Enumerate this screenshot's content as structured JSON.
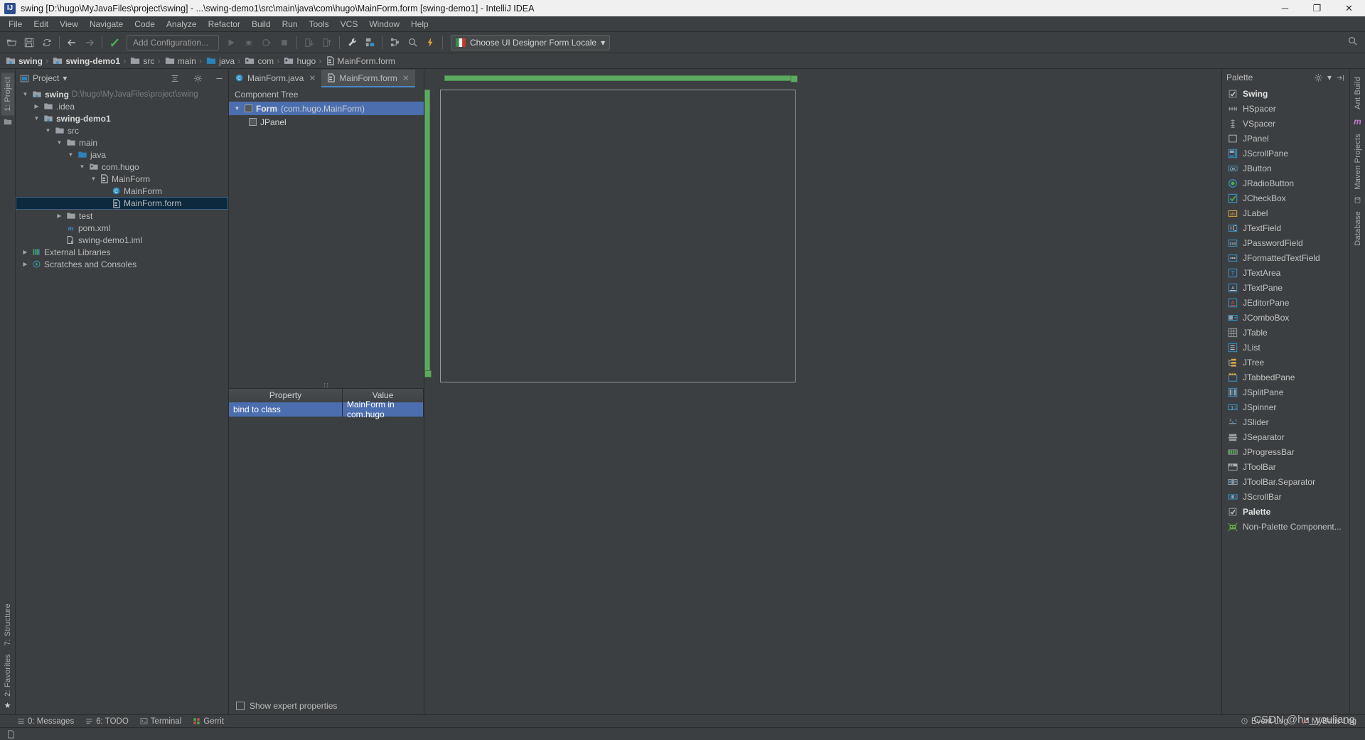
{
  "window": {
    "title": "swing [D:\\hugo\\MyJavaFiles\\project\\swing] - ...\\swing-demo1\\src\\main\\java\\com\\hugo\\MainForm.form [swing-demo1] - IntelliJ IDEA",
    "app_icon": "intellij-idea-icon",
    "minimize": "─",
    "maximize": "❐",
    "close": "✕"
  },
  "menubar": {
    "items": [
      {
        "label": "File"
      },
      {
        "label": "Edit"
      },
      {
        "label": "View"
      },
      {
        "label": "Navigate"
      },
      {
        "label": "Code"
      },
      {
        "label": "Analyze"
      },
      {
        "label": "Refactor"
      },
      {
        "label": "Build"
      },
      {
        "label": "Run"
      },
      {
        "label": "Tools"
      },
      {
        "label": "VCS"
      },
      {
        "label": "Window"
      },
      {
        "label": "Help"
      }
    ]
  },
  "toolbar": {
    "add_configuration": "Add Configuration...",
    "locale_label": "Choose UI Designer Form Locale",
    "locale_caret": "▾",
    "search_icon": "search-icon"
  },
  "breadcrumb": {
    "items": [
      {
        "label": "swing",
        "bold": true,
        "icon": "module-icon"
      },
      {
        "label": "swing-demo1",
        "bold": true,
        "icon": "module-icon"
      },
      {
        "label": "src",
        "bold": false,
        "icon": "folder-icon"
      },
      {
        "label": "main",
        "bold": false,
        "icon": "folder-icon"
      },
      {
        "label": "java",
        "bold": false,
        "icon": "source-folder-icon"
      },
      {
        "label": "com",
        "bold": false,
        "icon": "package-icon"
      },
      {
        "label": "hugo",
        "bold": false,
        "icon": "package-icon"
      },
      {
        "label": "MainForm.form",
        "bold": false,
        "icon": "form-file-icon"
      }
    ],
    "separator": "›"
  },
  "left_strip": {
    "project_tab": "1: Project",
    "structure_tab": "7: Structure",
    "favorites_tab": "2: Favorites"
  },
  "right_strip": {
    "tabs": [
      "Ant Build",
      "Maven Projects",
      "Database"
    ]
  },
  "project_panel": {
    "title": "Project",
    "caret": "▾",
    "collapse_icon": "collapse-all-icon",
    "settings_icon": "gear-icon",
    "hide_icon": "hide-icon",
    "tree": [
      {
        "label": "swing",
        "sub": "D:\\hugo\\MyJavaFiles\\project\\swing",
        "indent": 0,
        "arrow": "▼",
        "icon": "module-icon",
        "bold": true,
        "selected": false
      },
      {
        "label": ".idea",
        "sub": "",
        "indent": 1,
        "arrow": "▶",
        "icon": "folder-icon",
        "bold": false,
        "selected": false
      },
      {
        "label": "swing-demo1",
        "sub": "",
        "indent": 1,
        "arrow": "▼",
        "icon": "module-icon",
        "bold": true,
        "selected": false
      },
      {
        "label": "src",
        "sub": "",
        "indent": 2,
        "arrow": "▼",
        "icon": "folder-icon",
        "bold": false,
        "selected": false
      },
      {
        "label": "main",
        "sub": "",
        "indent": 3,
        "arrow": "▼",
        "icon": "folder-icon",
        "bold": false,
        "selected": false
      },
      {
        "label": "java",
        "sub": "",
        "indent": 4,
        "arrow": "▼",
        "icon": "source-folder-icon",
        "bold": false,
        "selected": false
      },
      {
        "label": "com.hugo",
        "sub": "",
        "indent": 5,
        "arrow": "▼",
        "icon": "package-icon",
        "bold": false,
        "selected": false
      },
      {
        "label": "MainForm",
        "sub": "",
        "indent": 6,
        "arrow": "▼",
        "icon": "form-file-icon",
        "bold": false,
        "selected": false
      },
      {
        "label": "MainForm",
        "sub": "",
        "indent": 7,
        "arrow": "",
        "icon": "java-class-icon",
        "bold": false,
        "selected": false
      },
      {
        "label": "MainForm.form",
        "sub": "",
        "indent": 7,
        "arrow": "",
        "icon": "form-file-icon",
        "bold": false,
        "selected": true
      },
      {
        "label": "test",
        "sub": "",
        "indent": 3,
        "arrow": "▶",
        "icon": "folder-icon",
        "bold": false,
        "selected": false
      },
      {
        "label": "pom.xml",
        "sub": "",
        "indent": 3,
        "arrow": "",
        "icon": "maven-icon",
        "bold": false,
        "selected": false
      },
      {
        "label": "swing-demo1.iml",
        "sub": "",
        "indent": 3,
        "arrow": "",
        "icon": "iml-file-icon",
        "bold": false,
        "selected": false
      },
      {
        "label": "External Libraries",
        "sub": "",
        "indent": 0,
        "arrow": "▶",
        "icon": "libraries-icon",
        "bold": false,
        "selected": false
      },
      {
        "label": "Scratches and Consoles",
        "sub": "",
        "indent": 0,
        "arrow": "▶",
        "icon": "scratches-icon",
        "bold": false,
        "selected": false
      }
    ]
  },
  "editor_tabs": [
    {
      "label": "MainForm.java",
      "icon": "java-class-icon",
      "active": false,
      "close": "✕"
    },
    {
      "label": "MainForm.form",
      "icon": "form-file-icon",
      "active": true,
      "close": "✕"
    }
  ],
  "component_tree": {
    "header": "Component Tree",
    "rows": [
      {
        "arrow": "▼",
        "name": "Form",
        "type": "(com.hugo.MainForm)",
        "indent": 0,
        "selected": true
      },
      {
        "arrow": "",
        "name": "JPanel",
        "type": "",
        "indent": 1,
        "selected": false
      }
    ]
  },
  "property_table": {
    "columns": [
      "Property",
      "Value"
    ],
    "rows": [
      {
        "property": "bind to class",
        "value": "MainForm in com.hugo",
        "selected": true
      }
    ],
    "show_expert_label": "Show expert properties",
    "show_expert_checked": false
  },
  "palette": {
    "title": "Palette",
    "settings_icon": "gear-icon",
    "caret": "▾",
    "hide_icon": "hide-icon",
    "groups": [
      {
        "label": "Swing",
        "checked": true,
        "items": [
          {
            "label": "HSpacer",
            "icon": "hspacer-icon"
          },
          {
            "label": "VSpacer",
            "icon": "vspacer-icon"
          },
          {
            "label": "JPanel",
            "icon": "jpanel-icon"
          },
          {
            "label": "JScrollPane",
            "icon": "jscrollpane-icon"
          },
          {
            "label": "JButton",
            "icon": "jbutton-icon"
          },
          {
            "label": "JRadioButton",
            "icon": "jradiobutton-icon"
          },
          {
            "label": "JCheckBox",
            "icon": "jcheckbox-icon"
          },
          {
            "label": "JLabel",
            "icon": "jlabel-icon"
          },
          {
            "label": "JTextField",
            "icon": "jtextfield-icon"
          },
          {
            "label": "JPasswordField",
            "icon": "jpasswordfield-icon"
          },
          {
            "label": "JFormattedTextField",
            "icon": "jformattedtextfield-icon"
          },
          {
            "label": "JTextArea",
            "icon": "jtextarea-icon"
          },
          {
            "label": "JTextPane",
            "icon": "jtextpane-icon"
          },
          {
            "label": "JEditorPane",
            "icon": "jeditorpane-icon"
          },
          {
            "label": "JComboBox",
            "icon": "jcombobox-icon"
          },
          {
            "label": "JTable",
            "icon": "jtable-icon"
          },
          {
            "label": "JList",
            "icon": "jlist-icon"
          },
          {
            "label": "JTree",
            "icon": "jtree-icon"
          },
          {
            "label": "JTabbedPane",
            "icon": "jtabbedpane-icon"
          },
          {
            "label": "JSplitPane",
            "icon": "jsplitpane-icon"
          },
          {
            "label": "JSpinner",
            "icon": "jspinner-icon"
          },
          {
            "label": "JSlider",
            "icon": "jslider-icon"
          },
          {
            "label": "JSeparator",
            "icon": "jseparator-icon"
          },
          {
            "label": "JProgressBar",
            "icon": "jprogressbar-icon"
          },
          {
            "label": "JToolBar",
            "icon": "jtoolbar-icon"
          },
          {
            "label": "JToolBar.Separator",
            "icon": "jtoolbar-separator-icon"
          },
          {
            "label": "JScrollBar",
            "icon": "jscrollbar-icon"
          }
        ]
      },
      {
        "label": "Palette",
        "checked": true,
        "items": [
          {
            "label": "Non-Palette Component...",
            "icon": "non-palette-component-icon"
          }
        ]
      }
    ]
  },
  "bottom_bar": {
    "left_items": [
      {
        "label": "0: Messages",
        "icon": "messages-icon"
      },
      {
        "label": "6: TODO",
        "icon": "todo-icon"
      },
      {
        "label": "Terminal",
        "icon": "terminal-icon"
      },
      {
        "label": "Gerrit",
        "icon": "gerrit-icon"
      }
    ],
    "right_items": [
      {
        "label": "Event Log",
        "icon": "event-log-icon"
      },
      {
        "label": "MyBatis Log",
        "icon": "mybatis-log-icon"
      }
    ]
  },
  "status_bar": {
    "icon": "document-icon",
    "text": ""
  },
  "watermark": "CSDN @hu_youliang",
  "colors": {
    "accent_blue": "#4b6eaf",
    "selection_tree": "#0d293e",
    "panel_bg": "#3c3f41",
    "border": "#2b2b2b",
    "green": "#5fa862",
    "tab_underline": "#4a88c7"
  }
}
